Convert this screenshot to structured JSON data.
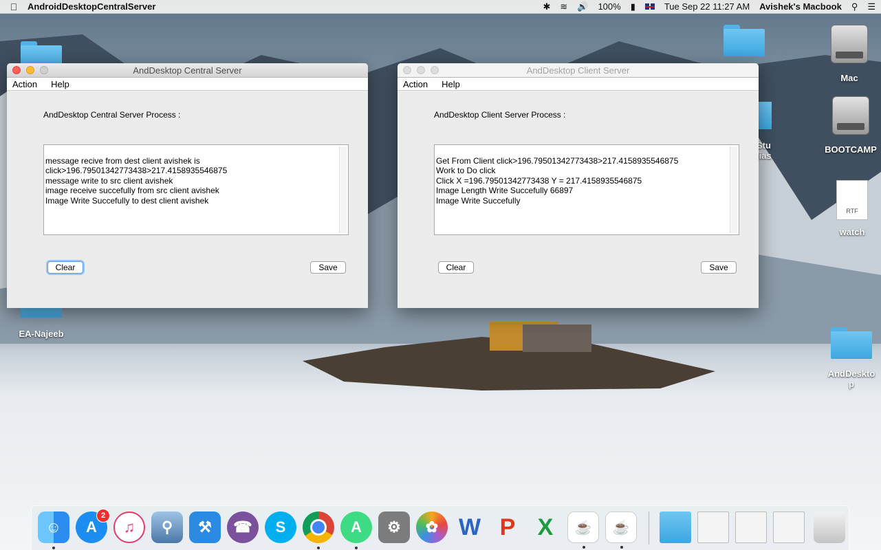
{
  "menubar": {
    "app_name": "AndroidDesktopCentralServer",
    "battery": "100%",
    "datetime": "Tue Sep 22  11:27 AM",
    "user": "Avishek's Macbook"
  },
  "desktop_icons": [
    {
      "label": "Mac"
    },
    {
      "label": "BOOTCAMP"
    },
    {
      "label": "watch"
    },
    {
      "label": "EA-Najeeb"
    },
    {
      "label": "AndDesktop"
    },
    {
      "label": "Stu"
    },
    {
      "label": "lias"
    }
  ],
  "central_window": {
    "title": "AndDesktop Central Server",
    "menu": [
      "Action",
      "Help"
    ],
    "process_label": "AndDesktop Central Server Process :",
    "log_text": "message recive from dest client avishek is\nclick>196.79501342773438>217.4158935546875\nmessage write to src client avishek\nimage receive succefully from src client avishek\nImage Write Succefully to dest client avishek",
    "clear_label": "Clear",
    "save_label": "Save"
  },
  "client_window": {
    "title": "AndDesktop Client Server",
    "menu": [
      "Action",
      "Help"
    ],
    "process_label": "AndDesktop Client Server Process :",
    "log_text": "Get From Client click>196.79501342773438>217.4158935546875\nWork to Do click\nClick X =196.79501342773438 Y = 217.4158935546875\nImage Length Write Succefully 66897\nImage Write Succefully",
    "clear_label": "Clear",
    "save_label": "Save"
  },
  "dock": {
    "appstore_badge": "2",
    "items": [
      "finder",
      "app-store",
      "itunes",
      "preview",
      "xcode",
      "viber",
      "skype",
      "chrome",
      "android-studio",
      "system-preferences",
      "photos",
      "word",
      "powerpoint",
      "excel",
      "java-1",
      "java-2",
      "downloads-folder",
      "window-thumb-1",
      "window-thumb-2",
      "window-thumb-3",
      "trash"
    ]
  },
  "colors": {
    "accent_focus": "#5e9ee8",
    "close": "#fc5f57",
    "minimize": "#fdbc2e",
    "folder": "#3ea6e0"
  }
}
